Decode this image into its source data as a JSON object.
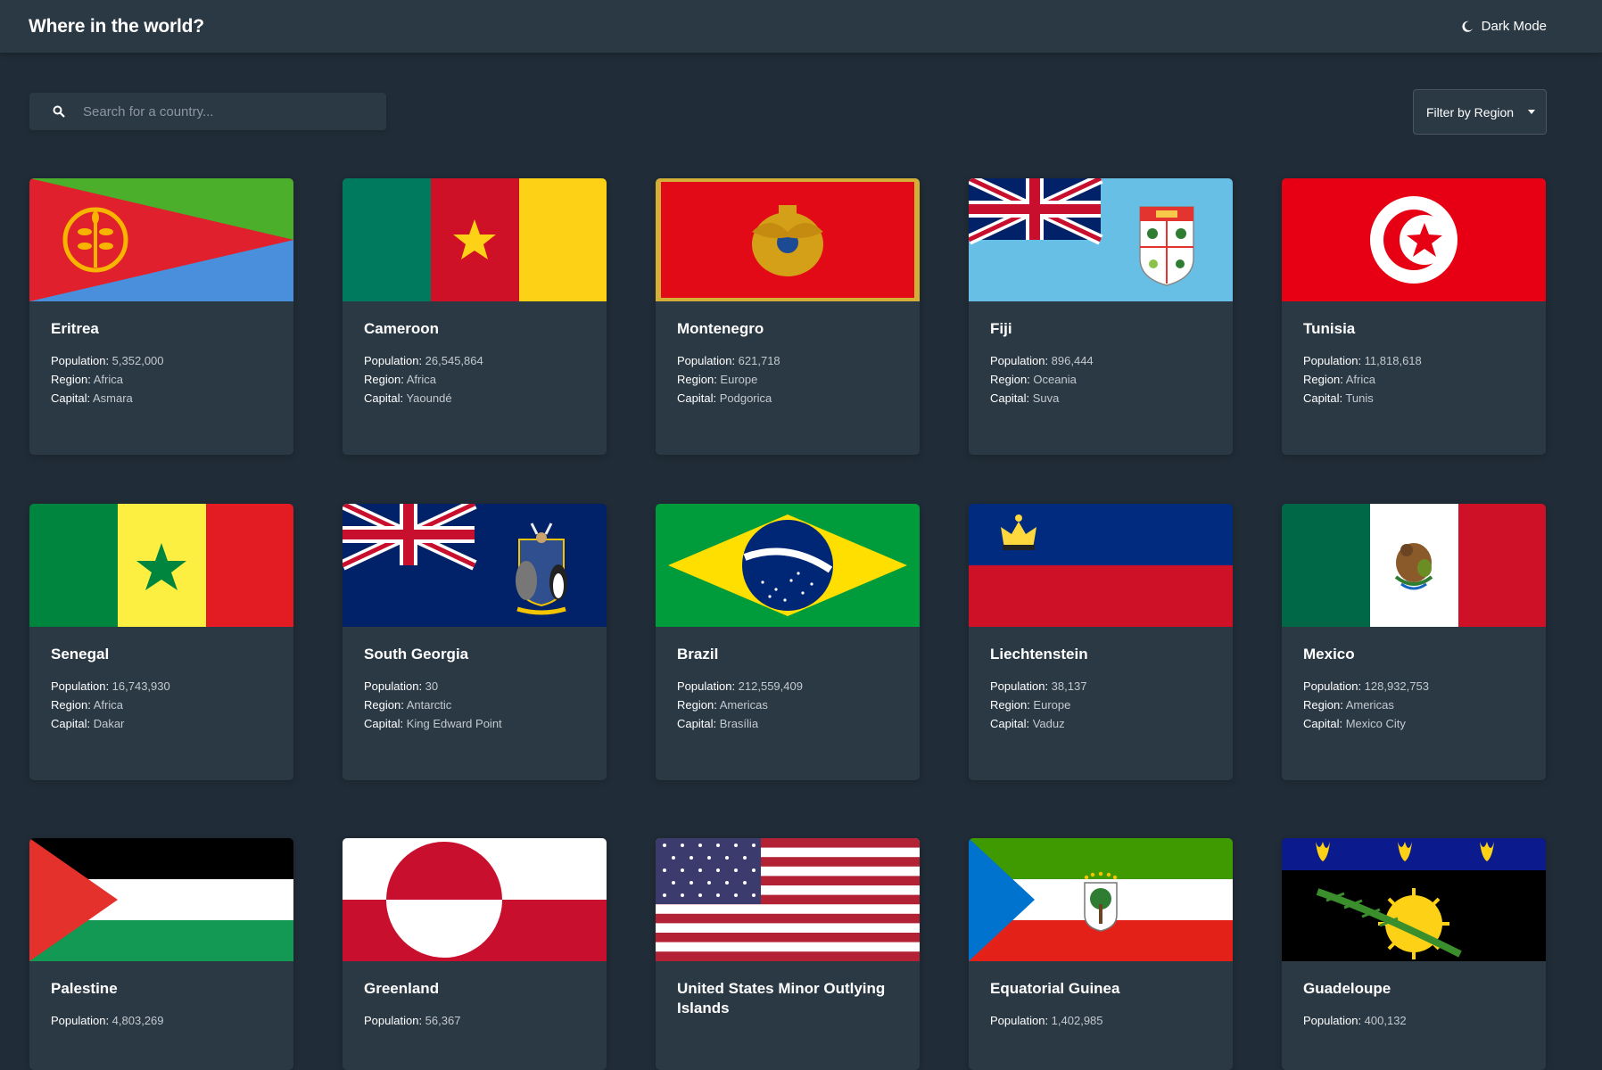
{
  "header": {
    "title": "Where in the world?",
    "theme_label": "Dark Mode"
  },
  "search": {
    "placeholder": "Search for a country..."
  },
  "filter": {
    "label": "Filter by Region"
  },
  "labels": {
    "population": "Population:",
    "region": "Region:",
    "capital": "Capital:"
  },
  "countries": [
    {
      "name": "Eritrea",
      "population": "5,352,000",
      "region": "Africa",
      "capital": "Asmara",
      "flag": "eritrea"
    },
    {
      "name": "Cameroon",
      "population": "26,545,864",
      "region": "Africa",
      "capital": "Yaoundé",
      "flag": "cameroon"
    },
    {
      "name": "Montenegro",
      "population": "621,718",
      "region": "Europe",
      "capital": "Podgorica",
      "flag": "montenegro"
    },
    {
      "name": "Fiji",
      "population": "896,444",
      "region": "Oceania",
      "capital": "Suva",
      "flag": "fiji"
    },
    {
      "name": "Tunisia",
      "population": "11,818,618",
      "region": "Africa",
      "capital": "Tunis",
      "flag": "tunisia"
    },
    {
      "name": "Senegal",
      "population": "16,743,930",
      "region": "Africa",
      "capital": "Dakar",
      "flag": "senegal"
    },
    {
      "name": "South Georgia",
      "population": "30",
      "region": "Antarctic",
      "capital": "King Edward Point",
      "flag": "south-georgia"
    },
    {
      "name": "Brazil",
      "population": "212,559,409",
      "region": "Americas",
      "capital": "Brasília",
      "flag": "brazil"
    },
    {
      "name": "Liechtenstein",
      "population": "38,137",
      "region": "Europe",
      "capital": "Vaduz",
      "flag": "liechtenstein"
    },
    {
      "name": "Mexico",
      "population": "128,932,753",
      "region": "Americas",
      "capital": "Mexico City",
      "flag": "mexico"
    },
    {
      "name": "Palestine",
      "population": "4,803,269",
      "region": "",
      "capital": "",
      "flag": "palestine"
    },
    {
      "name": "Greenland",
      "population": "56,367",
      "region": "",
      "capital": "",
      "flag": "greenland"
    },
    {
      "name": "United States Minor Outlying Islands",
      "population": "",
      "region": "",
      "capital": "",
      "flag": "united-states"
    },
    {
      "name": "Equatorial Guinea",
      "population": "1,402,985",
      "region": "",
      "capital": "",
      "flag": "equatorial-guinea"
    },
    {
      "name": "Guadeloupe",
      "population": "400,132",
      "region": "",
      "capital": "",
      "flag": "guadeloupe"
    }
  ]
}
